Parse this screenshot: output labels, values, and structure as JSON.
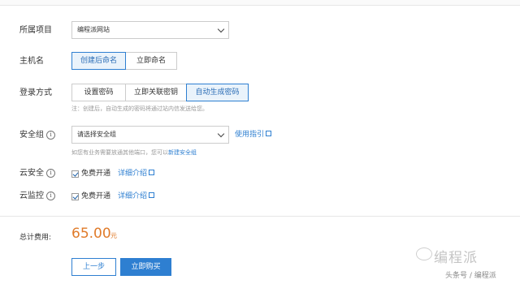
{
  "form": {
    "project_label": "所属项目",
    "project_value": "编程派网站",
    "hostname_label": "主机名",
    "hostname_options": [
      "创建后命名",
      "立即命名"
    ],
    "hostname_selected": "创建后命名",
    "login_label": "登录方式",
    "login_options": [
      "设置密码",
      "立即关联密钥",
      "自动生成密码"
    ],
    "login_selected": "自动生成密码",
    "login_note": "注：创建后，自动生成的密码将通过站内信发送给您。",
    "security_group_label": "安全组",
    "security_group_placeholder": "请选择安全组",
    "security_group_guide": "使用指引",
    "security_note_prefix": "如您有业务需要放通其他端口，您可以",
    "security_note_link": "新建安全组",
    "cloud_security_label": "云安全",
    "cloud_security_check": "免费开通",
    "cloud_security_detail": "详细介绍",
    "cloud_monitor_label": "云监控",
    "cloud_monitor_check": "免费开通",
    "cloud_monitor_detail": "详细介绍"
  },
  "footer": {
    "total_label": "总计费用:",
    "price": "65.00",
    "unit": "元",
    "prev_button": "上一步",
    "buy_button": "立即购买"
  },
  "watermark": {
    "main": "编程派",
    "sub": "头条号 / 编程派"
  },
  "colors": {
    "accent": "#2e7fd1",
    "price": "#e07b2a",
    "active_bg": "#eaf3fb"
  }
}
